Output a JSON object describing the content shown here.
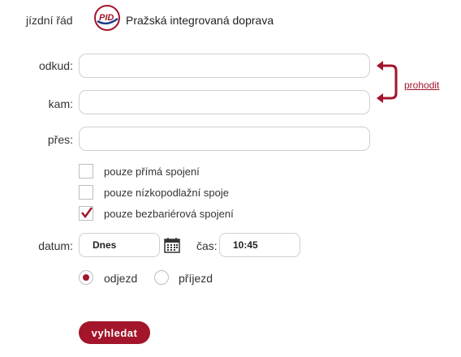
{
  "header": {
    "timetable_label": "jízdní řád",
    "logo_text": "PID",
    "organization": "Pražská integrovaná doprava"
  },
  "form": {
    "from_label": "odkud:",
    "from_value": "",
    "to_label": "kam:",
    "to_value": "",
    "via_label": "přes:",
    "via_value": "",
    "swap_label": "prohodit",
    "options": [
      {
        "label": "pouze přímá spojení",
        "checked": false
      },
      {
        "label": "pouze nízkopodlažní spoje",
        "checked": false
      },
      {
        "label": "pouze bezbariérová spojení",
        "checked": true
      }
    ],
    "date_label": "datum:",
    "date_value": "Dnes",
    "time_label": "čas:",
    "time_value": "10:45",
    "direction": [
      {
        "label": "odjezd",
        "selected": true
      },
      {
        "label": "příjezd",
        "selected": false
      }
    ],
    "submit_label": "vyhledat"
  },
  "colors": {
    "accent": "#a3152a",
    "border": "#cfcfcf"
  }
}
